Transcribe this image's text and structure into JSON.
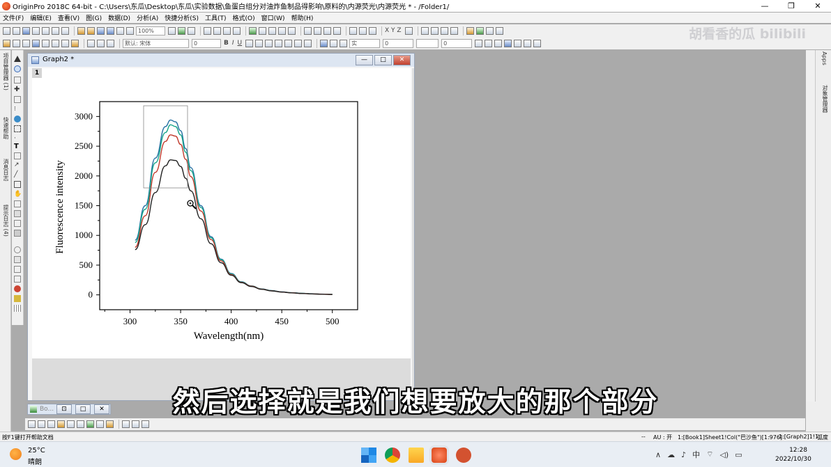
{
  "app": {
    "title": "OriginPro 2018C 64-bit - C:\\Users\\东瓜\\Desktop\\东瓜\\实验数据\\鱼蛋白组分对油炸鱼制品得影响\\原料的\\内源荧光\\内源荧光 * - /Folder1/",
    "window_controls": [
      "—",
      "❐",
      "✕"
    ]
  },
  "menu": [
    "文件(F)",
    "编辑(E)",
    "查看(V)",
    "图(G)",
    "数据(D)",
    "分析(A)",
    "快捷分析(S)",
    "工具(T)",
    "格式(O)",
    "窗口(W)",
    "帮助(H)"
  ],
  "toolbar": {
    "zoom": "100%",
    "font": "默认: 宋体",
    "font_size": "0",
    "bold": "B",
    "italic": "I",
    "underline": "U",
    "line_width": "0",
    "line_style_label": "实",
    "axes_labels": "X Y Z"
  },
  "watermark": "胡看香的瓜 bilibili",
  "left_panel_tabs": [
    "项目管理器 (1)",
    "快速帮助",
    "消息日志",
    "提示日志 (4)"
  ],
  "right_panel_tabs": [
    "Apps",
    "对象管理器"
  ],
  "graph_window": {
    "title": "Graph2 *",
    "layer": "1",
    "buttons": [
      "—",
      "□",
      "✕"
    ]
  },
  "minimized_window": {
    "label": "Bo...",
    "buttons": [
      "⊡",
      "□",
      "✕"
    ]
  },
  "chart_data": {
    "type": "line",
    "xlabel": "Wavelength(nm)",
    "ylabel": "Fluorescence intensity",
    "xlim": [
      270,
      525
    ],
    "ylim": [
      -250,
      3250
    ],
    "xticks": [
      300,
      350,
      400,
      450,
      500
    ],
    "yticks": [
      0,
      500,
      1000,
      1500,
      2000,
      2500,
      3000
    ],
    "grid": false,
    "legend": "none",
    "series": [
      {
        "color": "#2471a3",
        "x": [
          305,
          315,
          325,
          335,
          340,
          345,
          350,
          355,
          360,
          370,
          380,
          390,
          400,
          410,
          420,
          430,
          440,
          450,
          460,
          470,
          480,
          490,
          500
        ],
        "values": [
          920,
          1500,
          2300,
          2830,
          2940,
          2910,
          2760,
          2460,
          2140,
          1500,
          980,
          600,
          360,
          220,
          150,
          100,
          72,
          50,
          36,
          26,
          18,
          12,
          8
        ]
      },
      {
        "color": "#17a589",
        "x": [
          305,
          315,
          325,
          335,
          340,
          345,
          350,
          355,
          360,
          370,
          380,
          390,
          400,
          410,
          420,
          430,
          440,
          450,
          460,
          470,
          480,
          490,
          500
        ],
        "values": [
          880,
          1440,
          2220,
          2730,
          2860,
          2830,
          2690,
          2400,
          2090,
          1470,
          960,
          590,
          350,
          215,
          148,
          98,
          70,
          48,
          35,
          25,
          17,
          11,
          8
        ]
      },
      {
        "color": "#c0392b",
        "x": [
          305,
          315,
          325,
          335,
          340,
          345,
          350,
          355,
          360,
          370,
          380,
          390,
          400,
          410,
          420,
          430,
          440,
          450,
          460,
          470,
          480,
          490,
          500
        ],
        "values": [
          800,
          1330,
          2060,
          2580,
          2690,
          2670,
          2530,
          2280,
          1990,
          1410,
          930,
          570,
          340,
          210,
          145,
          96,
          68,
          47,
          34,
          24,
          16,
          11,
          7
        ]
      },
      {
        "color": "#222222",
        "x": [
          305,
          315,
          325,
          335,
          340,
          345,
          350,
          355,
          360,
          370,
          380,
          390,
          400,
          410,
          420,
          430,
          440,
          450,
          460,
          470,
          480,
          490,
          500
        ],
        "values": [
          760,
          1180,
          1720,
          2170,
          2270,
          2260,
          2160,
          1960,
          1750,
          1280,
          860,
          540,
          330,
          205,
          140,
          93,
          66,
          46,
          33,
          23,
          16,
          10,
          7
        ]
      }
    ]
  },
  "status": {
    "hint": "按F1键打开帮助文档",
    "dash": "--",
    "au": "AU : 开",
    "info": "1:[Book1]Sheet1!Col(\"巴沙鱼\")[1:976]",
    "graph": "1:[Graph2]1!1",
    "unit": "弧度"
  },
  "subtitle": "然后选择就是我们想要放大的那个部分",
  "taskbar": {
    "temp": "25°C",
    "condition": "晴朗",
    "tray": [
      "∧",
      "☁",
      "♪",
      "中",
      "⌔",
      "◁)",
      "▭"
    ],
    "time": "12:28",
    "date": "2022/10/30"
  }
}
